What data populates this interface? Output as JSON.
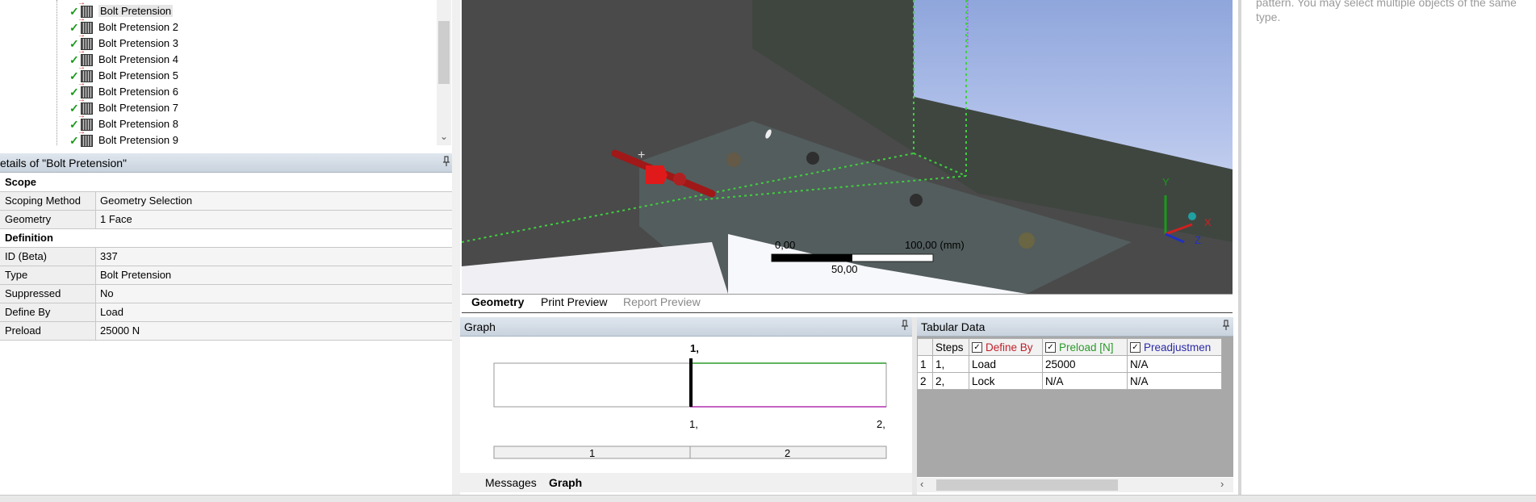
{
  "tree": {
    "items": [
      {
        "label": "Bolt Pretension",
        "selected": true
      },
      {
        "label": "Bolt Pretension 2"
      },
      {
        "label": "Bolt Pretension 3"
      },
      {
        "label": "Bolt Pretension 4"
      },
      {
        "label": "Bolt Pretension 5"
      },
      {
        "label": "Bolt Pretension 6"
      },
      {
        "label": "Bolt Pretension 7"
      },
      {
        "label": "Bolt Pretension 8"
      },
      {
        "label": "Bolt Pretension 9"
      }
    ]
  },
  "details": {
    "title": "etails of \"Bolt Pretension\"",
    "sections": {
      "scope": "Scope",
      "definition": "Definition"
    },
    "rows": {
      "scoping_method": {
        "key": "Scoping Method",
        "value": "Geometry Selection"
      },
      "geometry": {
        "key": "Geometry",
        "value": "1 Face"
      },
      "id": {
        "key": "ID (Beta)",
        "value": "337"
      },
      "type": {
        "key": "Type",
        "value": "Bolt Pretension"
      },
      "suppressed": {
        "key": "Suppressed",
        "value": "No"
      },
      "define_by": {
        "key": "Define By",
        "value": "Load"
      },
      "preload": {
        "key": "Preload",
        "value": "25000 N"
      }
    }
  },
  "viewport": {
    "scale": {
      "left": "0,00",
      "right": "100,00 (mm)",
      "mid": "50,00"
    },
    "triad": {
      "x": "X",
      "y": "Y",
      "z": "Z"
    },
    "tabs": {
      "geometry": "Geometry",
      "print": "Print Preview",
      "report": "Report Preview"
    }
  },
  "graph": {
    "title": "Graph",
    "top_label": "1,",
    "x_labels": [
      "1,",
      "2,"
    ],
    "steps": [
      "1",
      "2"
    ],
    "tabs": {
      "messages": "Messages",
      "graph": "Graph"
    }
  },
  "tabular": {
    "title": "Tabular Data",
    "headers": {
      "steps": "Steps",
      "define_by": "Define By",
      "preload": "Preload [N]",
      "preadj": "Preadjustmen"
    },
    "rows": [
      {
        "n": "1",
        "step": "1,",
        "define_by": "Load",
        "preload": "25000",
        "preadj": "N/A"
      },
      {
        "n": "2",
        "step": "2,",
        "define_by": "Lock",
        "preload": "N/A",
        "preadj": "N/A"
      }
    ],
    "colors": {
      "define_by": "#c0202a",
      "preload": "#2a9a2a",
      "preadj": "#2a2aa8"
    }
  },
  "right_panel": {
    "text": "pattern. You may select multiple objects of the same type."
  },
  "icons": {
    "pin": "📌",
    "check": "✓",
    "chevron_down": "⌄",
    "arrow_left": "‹",
    "arrow_right": "›"
  }
}
